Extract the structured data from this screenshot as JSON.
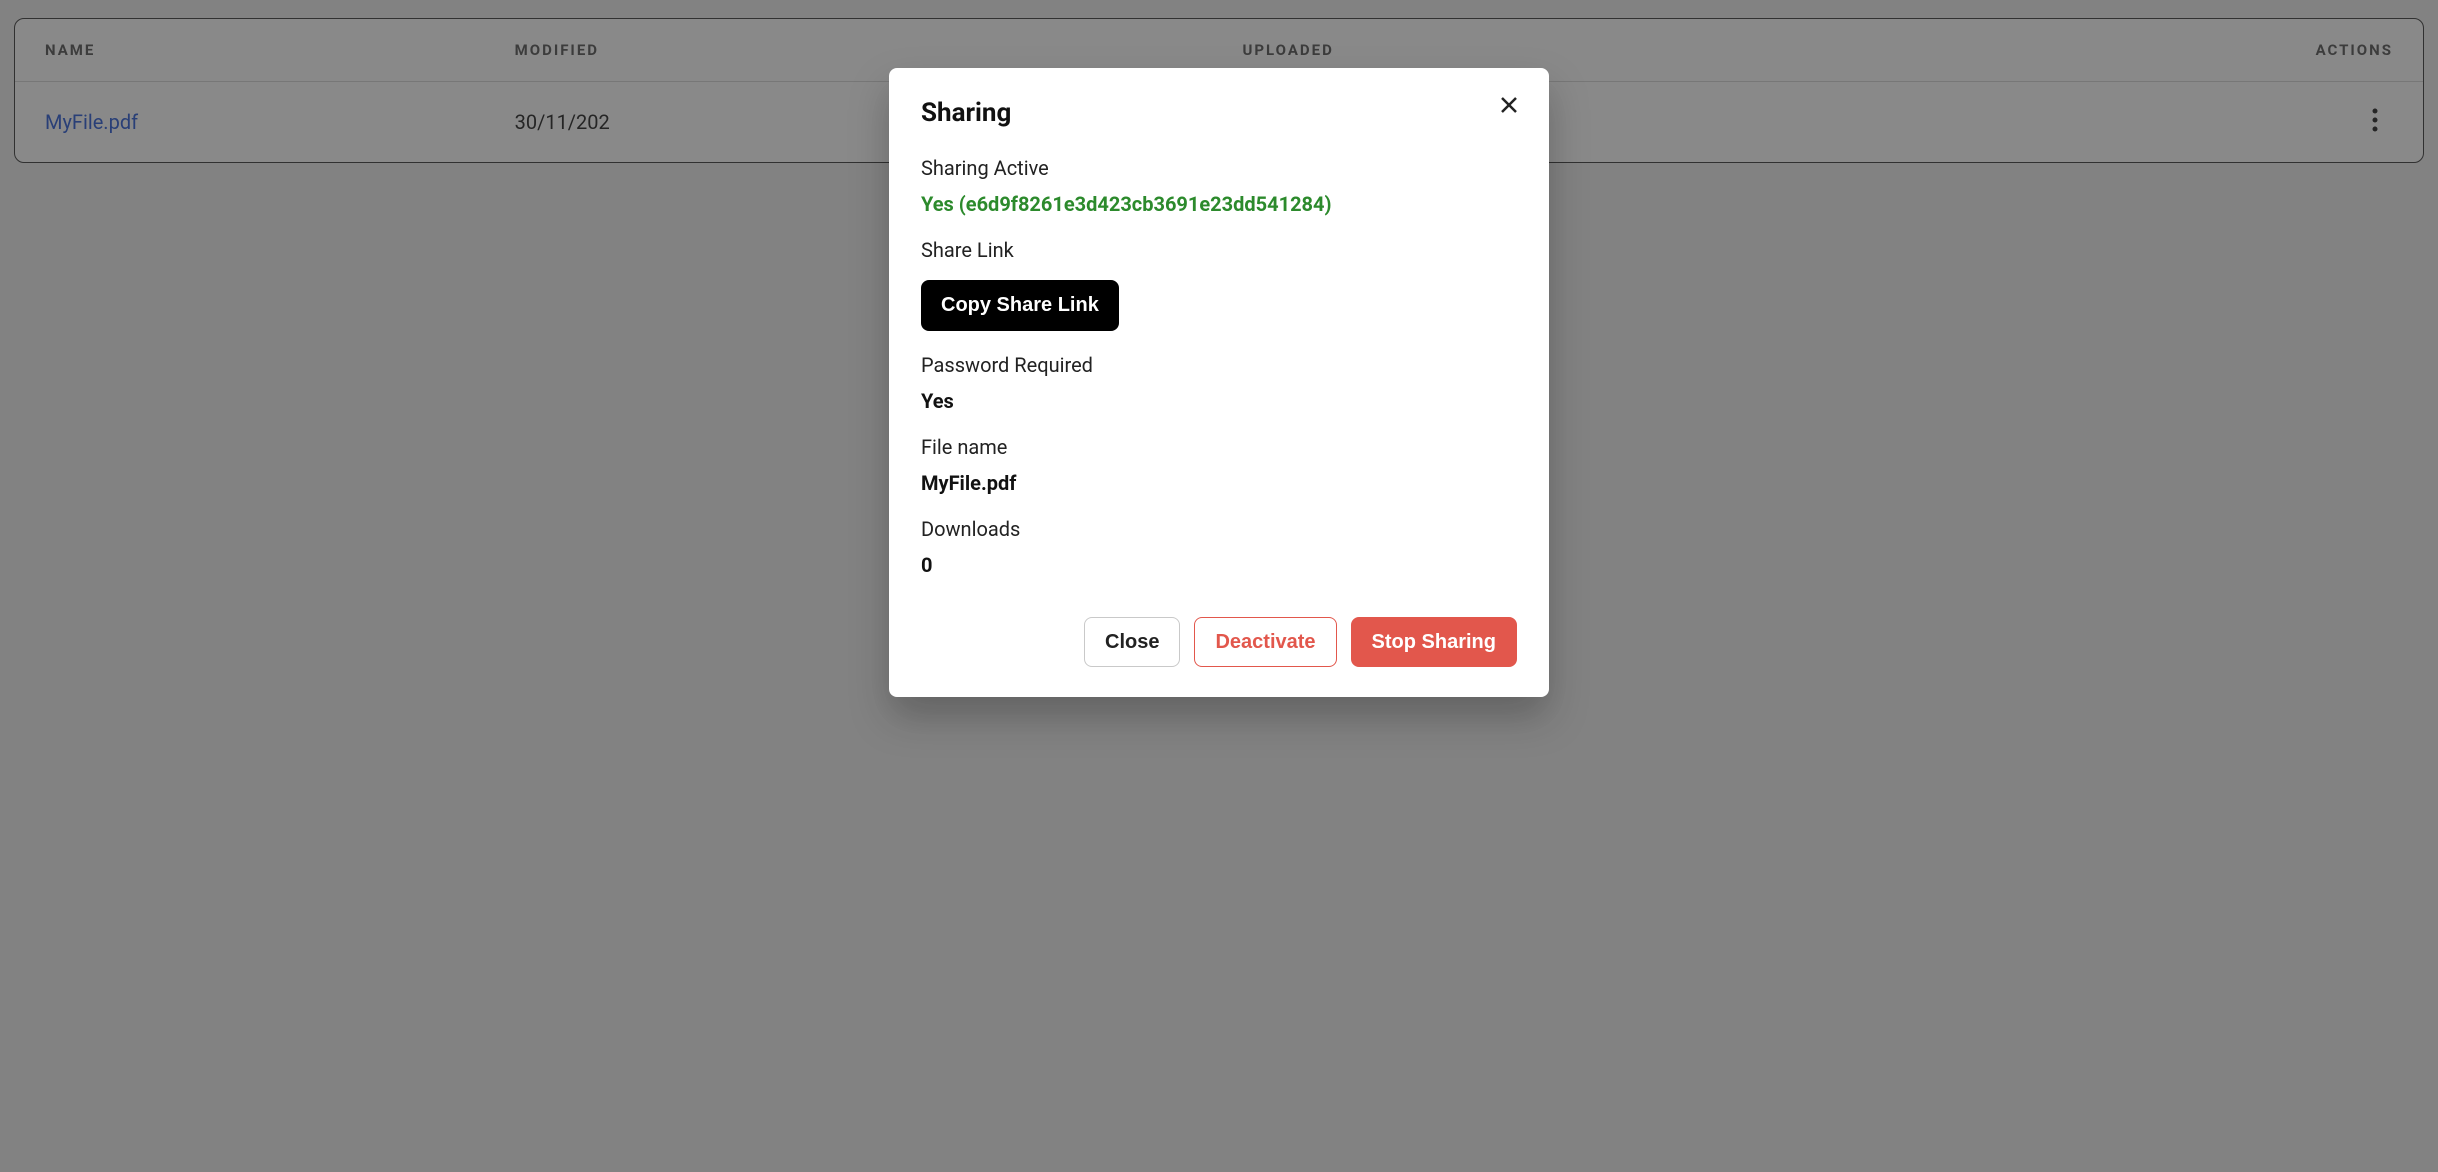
{
  "table": {
    "headers": {
      "name": "NAME",
      "modified": "MODIFIED",
      "uploaded": "UPLOADED",
      "actions": "ACTIONS"
    },
    "rows": [
      {
        "name": "MyFile.pdf",
        "modified": "30/11/202",
        "uploaded": ""
      }
    ]
  },
  "modal": {
    "title": "Sharing",
    "labels": {
      "sharing_active": "Sharing Active",
      "share_link": "Share Link",
      "password_required": "Password Required",
      "file_name": "File name",
      "downloads": "Downloads"
    },
    "values": {
      "sharing_active": "Yes (e6d9f8261e3d423cb3691e23dd541284)",
      "password_required": "Yes",
      "file_name": "MyFile.pdf",
      "downloads": "0"
    },
    "buttons": {
      "copy": "Copy Share Link",
      "close": "Close",
      "deactivate": "Deactivate",
      "stop_sharing": "Stop Sharing"
    }
  }
}
